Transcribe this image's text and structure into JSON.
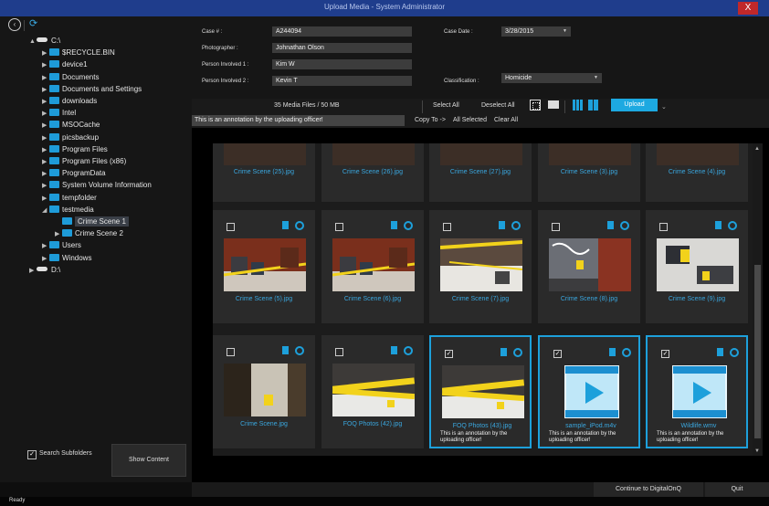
{
  "window": {
    "title": "Upload Media - System Administrator",
    "close_glyph": "X"
  },
  "tree": [
    {
      "label": "C:\\",
      "type": "drive",
      "expand": "▲"
    },
    {
      "label": "$RECYCLE.BIN",
      "type": "folder",
      "expand": "▶"
    },
    {
      "label": "device1",
      "type": "folder",
      "expand": "▶"
    },
    {
      "label": "Documents",
      "type": "folder",
      "expand": "▶"
    },
    {
      "label": "Documents and Settings",
      "type": "folder",
      "expand": "▶"
    },
    {
      "label": "downloads",
      "type": "folder",
      "expand": "▶"
    },
    {
      "label": "Intel",
      "type": "folder",
      "expand": "▶"
    },
    {
      "label": "MSOCache",
      "type": "folder",
      "expand": "▶"
    },
    {
      "label": "picsbackup",
      "type": "folder",
      "expand": "▶"
    },
    {
      "label": "Program Files",
      "type": "folder",
      "expand": "▶"
    },
    {
      "label": "Program Files (x86)",
      "type": "folder",
      "expand": "▶"
    },
    {
      "label": "ProgramData",
      "type": "folder",
      "expand": "▶"
    },
    {
      "label": "System Volume Information",
      "type": "folder",
      "expand": "▶"
    },
    {
      "label": "tempfolder",
      "type": "folder",
      "expand": "▶"
    },
    {
      "label": "testmedia",
      "type": "folder",
      "expand": "◢"
    },
    {
      "label": "Crime Scene 1",
      "type": "folder",
      "expand": "",
      "selected": true
    },
    {
      "label": "Crime Scene 2",
      "type": "folder",
      "expand": "▶"
    },
    {
      "label": "Users",
      "type": "folder",
      "expand": "▶"
    },
    {
      "label": "Windows",
      "type": "folder",
      "expand": "▶"
    },
    {
      "label": "D:\\",
      "type": "drive",
      "expand": "▶"
    }
  ],
  "left": {
    "search_subfolders": "Search Subfolders",
    "show_content": "Show Content"
  },
  "form": {
    "case_label": "Case # :",
    "case_value": "A244094",
    "photographer_label": "Photographer :",
    "photographer_value": "Johnathan Olson",
    "person1_label": "Person Involved 1 :",
    "person1_value": "Kim W",
    "person2_label": "Person Involved 2 :",
    "person2_value": "Kevin T",
    "case_date_label": "Case Date :",
    "case_date_value": "3/28/2015",
    "classification_label": "Classification :",
    "classification_value": "Homicide"
  },
  "toolbar": {
    "media_count": "35 Media Files / 50 MB",
    "select_all": "Select All",
    "deselect_all": "Deselect All",
    "upload": "Upload",
    "annotation": "This is an annotation by the uploading officer!",
    "copy_to": "Copy To ->",
    "all_selected": "All Selected",
    "clear_all": "Clear All"
  },
  "top_row": [
    "Crime Scene (25).jpg",
    "Crime Scene (26).jpg",
    "Crime Scene (27).jpg",
    "Crime Scene (3).jpg",
    "Crime Scene (4).jpg"
  ],
  "cards": [
    {
      "name": "Crime Scene (5).jpg",
      "checked": false,
      "kind": "brick",
      "note": ""
    },
    {
      "name": "Crime Scene (6).jpg",
      "checked": false,
      "kind": "brick",
      "note": ""
    },
    {
      "name": "Crime Scene (7).jpg",
      "checked": false,
      "kind": "snowtape",
      "note": ""
    },
    {
      "name": "Crime Scene (8).jpg",
      "checked": false,
      "kind": "graffiti",
      "note": ""
    },
    {
      "name": "Crime Scene (9).jpg",
      "checked": false,
      "kind": "marker",
      "note": ""
    },
    {
      "name": "Crime Scene.jpg",
      "checked": false,
      "kind": "ground",
      "note": ""
    },
    {
      "name": "FOQ Photos (42).jpg",
      "checked": false,
      "kind": "tape",
      "note": ""
    },
    {
      "name": "FOQ Photos (43).jpg",
      "checked": true,
      "kind": "tape",
      "note": "This is an annotation by the uploading officer!"
    },
    {
      "name": "sample_iPod.m4v",
      "checked": true,
      "kind": "video",
      "note": "This is an annotation by the uploading officer!"
    },
    {
      "name": "Wildlife.wmv",
      "checked": true,
      "kind": "video",
      "note": "This is an annotation by the uploading officer!"
    }
  ],
  "bottom": {
    "continue": "Continue to DigitalOnQ",
    "quit": "Quit",
    "status": "Ready"
  },
  "colors": {
    "accent": "#1da0db",
    "titlebar": "#1f3d8c",
    "close": "#c0282a",
    "folder": "#1e9bd8"
  }
}
